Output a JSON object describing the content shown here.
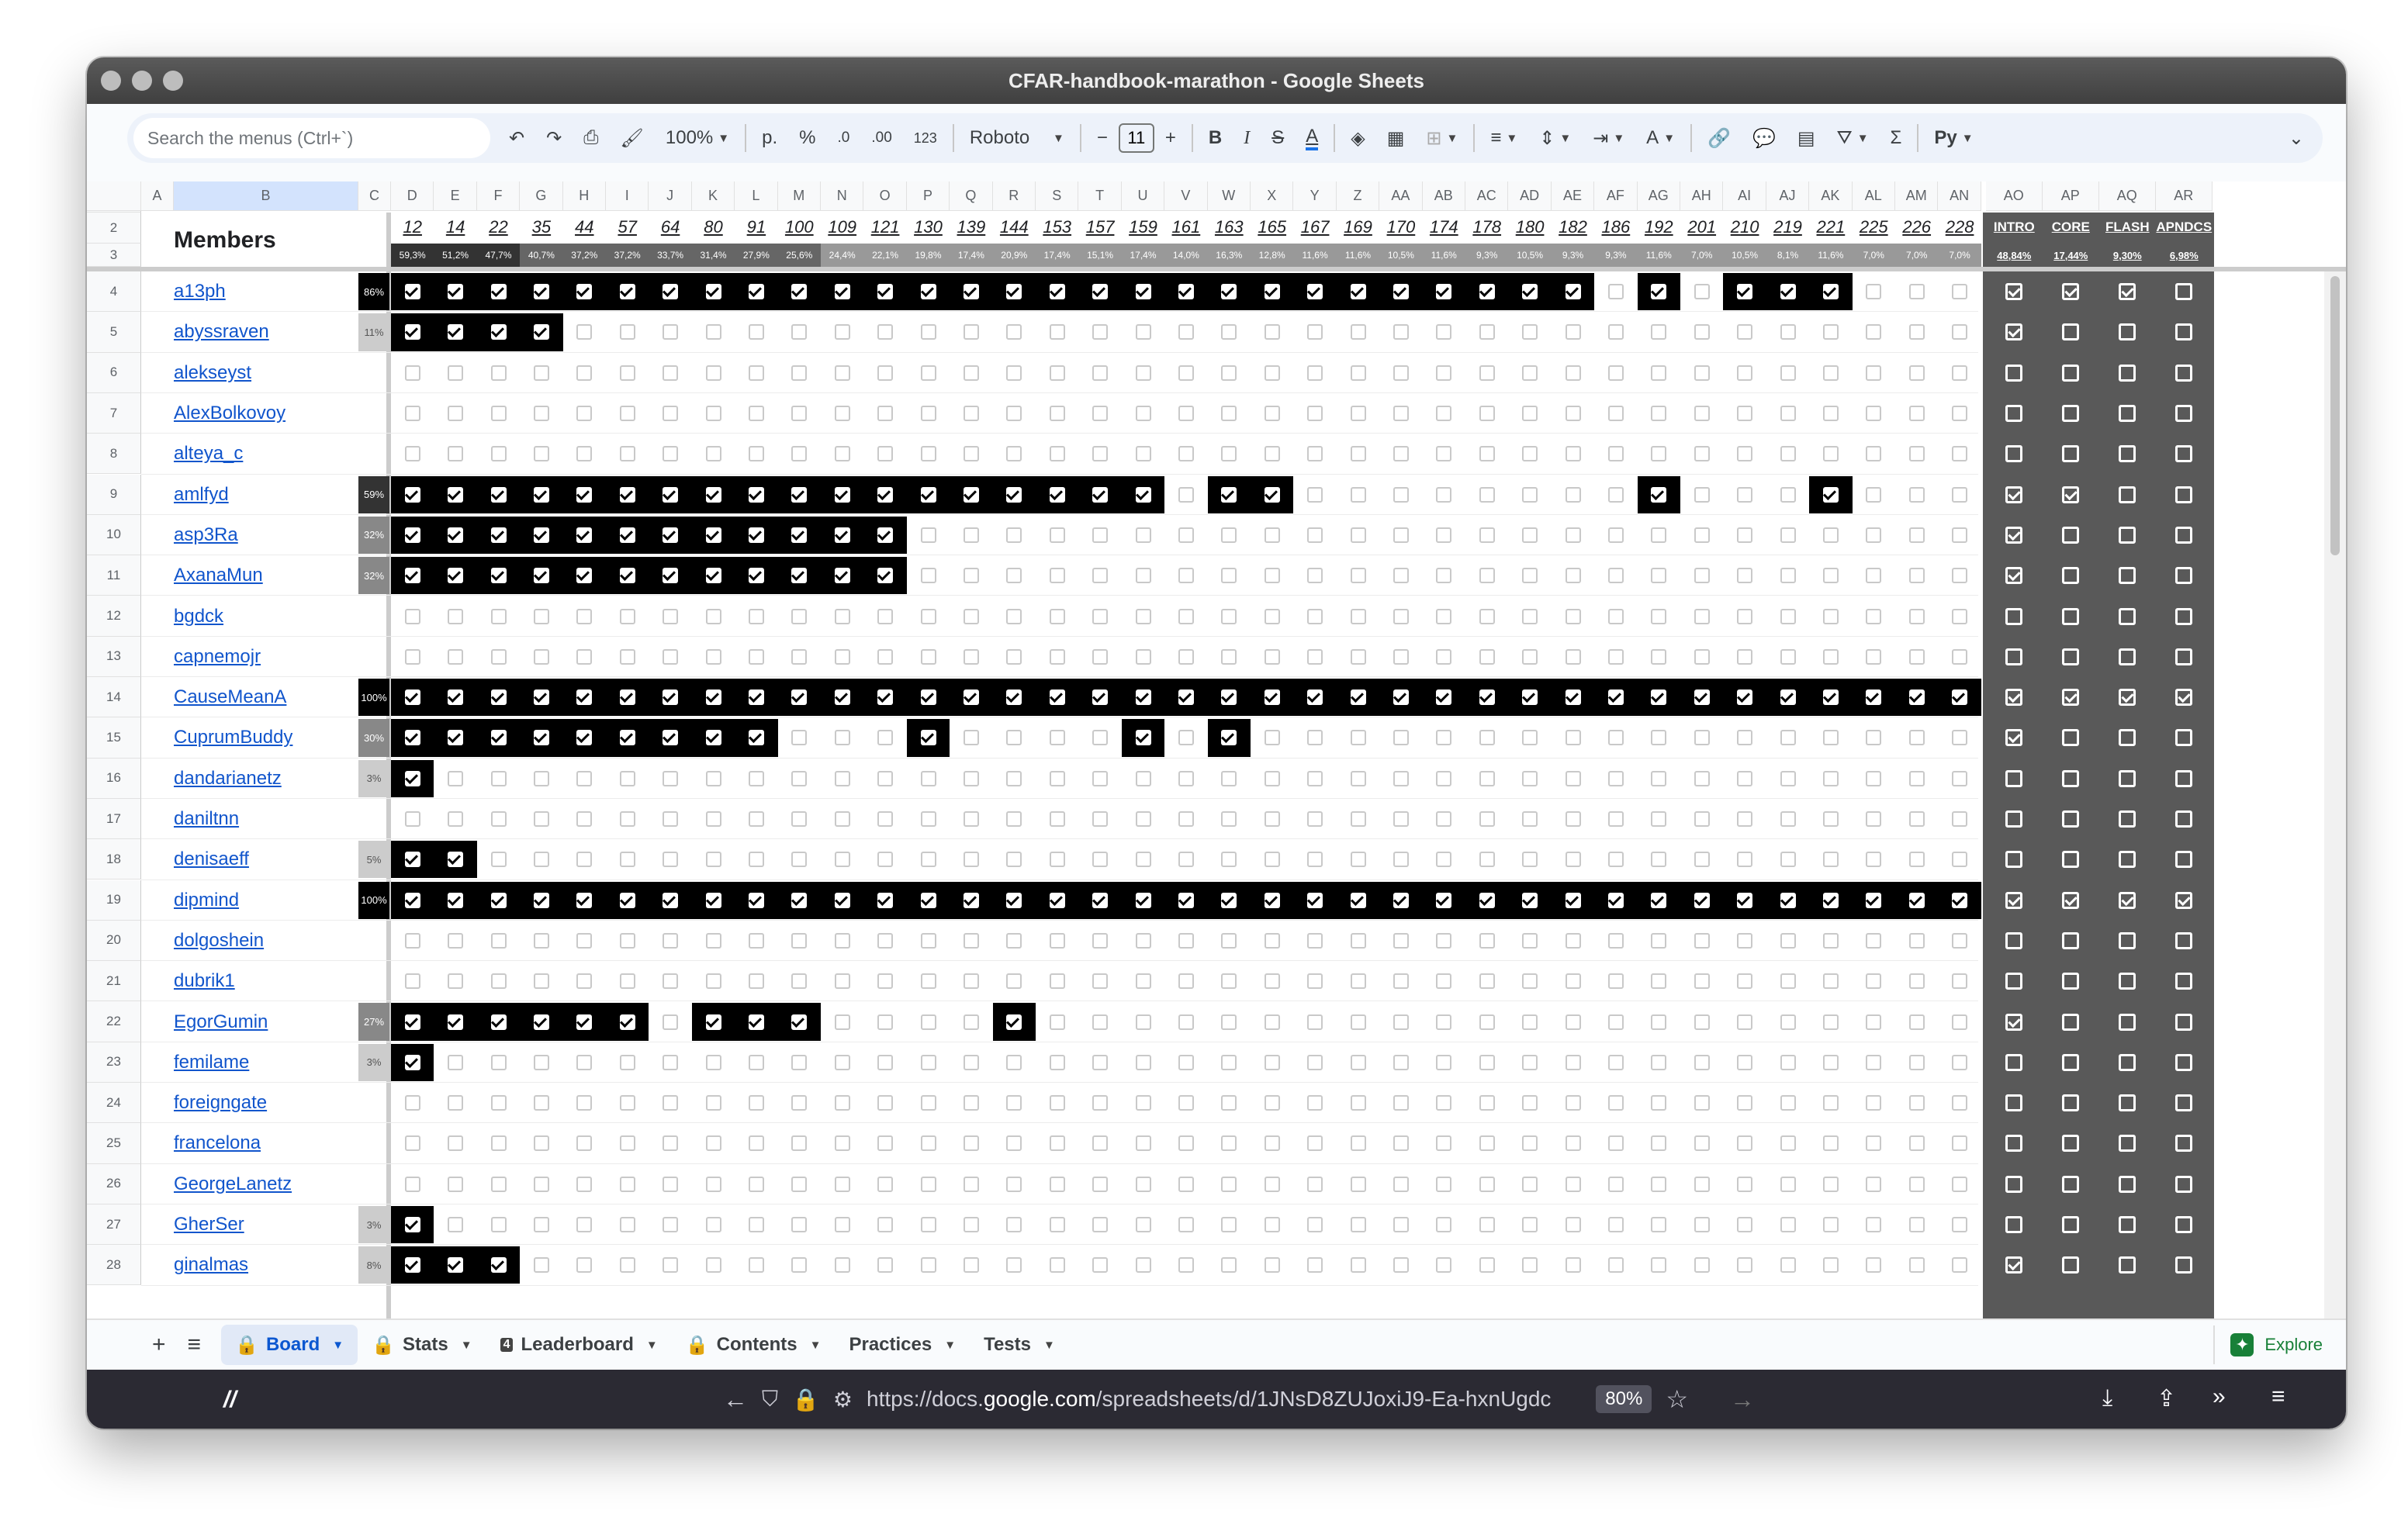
{
  "window": {
    "title": "CFAR-handbook-marathon - Google Sheets"
  },
  "toolbar": {
    "search_placeholder": "Search the menus (Ctrl+`)",
    "zoom": "100%",
    "currency": "р.",
    "percent": "%",
    "dec_decrease": ".0",
    "dec_increase": ".00",
    "number_format": "123",
    "font": "Roboto",
    "font_size": "11",
    "bold": "B",
    "italic": "I",
    "font_color": "A",
    "text_color": "A"
  },
  "columns": [
    "A",
    "B",
    "C",
    "D",
    "E",
    "F",
    "G",
    "H",
    "I",
    "J",
    "K",
    "L",
    "M",
    "N",
    "O",
    "P",
    "Q",
    "R",
    "S",
    "T",
    "U",
    "V",
    "W",
    "X",
    "Y",
    "Z",
    "AA",
    "AB",
    "AC",
    "AD",
    "AE",
    "AF",
    "AG",
    "AH",
    "AI",
    "AJ",
    "AK",
    "AL",
    "AM",
    "AN",
    "AO",
    "AP",
    "AQ",
    "AR"
  ],
  "members_header": "Members",
  "lessons": [
    "12",
    "14",
    "22",
    "35",
    "44",
    "57",
    "64",
    "80",
    "91",
    "100",
    "109",
    "121",
    "130",
    "139",
    "144",
    "153",
    "157",
    "159",
    "161",
    "163",
    "165",
    "167",
    "169",
    "170",
    "174",
    "178",
    "180",
    "182",
    "186",
    "192",
    "201",
    "210",
    "219",
    "221",
    "225",
    "226",
    "228"
  ],
  "lesson_pcts": [
    "59,3%",
    "51,2%",
    "47,7%",
    "40,7%",
    "37,2%",
    "37,2%",
    "33,7%",
    "31,4%",
    "27,9%",
    "25,6%",
    "24,4%",
    "22,1%",
    "19,8%",
    "17,4%",
    "20,9%",
    "17,4%",
    "15,1%",
    "17,4%",
    "14,0%",
    "16,3%",
    "12,8%",
    "11,6%",
    "11,6%",
    "10,5%",
    "11,6%",
    "9,3%",
    "10,5%",
    "9,3%",
    "9,3%",
    "11,6%",
    "7,0%",
    "10,5%",
    "8,1%",
    "11,6%",
    "7,0%",
    "7,0%",
    "7,0%"
  ],
  "categories": [
    "INTRO",
    "CORE",
    "FLASH",
    "APNDCS"
  ],
  "category_pcts": [
    "48,84%",
    "17,44%",
    "9,30%",
    "6,98%"
  ],
  "rows": [
    {
      "num": "4",
      "name": "a13ph",
      "pct": "86%",
      "done": "1111111111111111111111111111010111000",
      "cat": "1110"
    },
    {
      "num": "5",
      "name": "abyssraven",
      "pct": "11%",
      "done": "1111000000000000000000000000000000000",
      "cat": "1000"
    },
    {
      "num": "6",
      "name": "alekseyst",
      "pct": "",
      "done": "0000000000000000000000000000000000000",
      "cat": "0000"
    },
    {
      "num": "7",
      "name": "AlexBolkovoy",
      "pct": "",
      "done": "0000000000000000000000000000000000000",
      "cat": "0000"
    },
    {
      "num": "8",
      "name": "alteya_c",
      "pct": "",
      "done": "0000000000000000000000000000000000000",
      "cat": "0000"
    },
    {
      "num": "9",
      "name": "amlfyd",
      "pct": "59%",
      "done": "1111111111111111110110000000010001000",
      "cat": "1100"
    },
    {
      "num": "10",
      "name": "asp3Ra",
      "pct": "32%",
      "done": "1111111111110000000000000000000000000",
      "cat": "1000"
    },
    {
      "num": "11",
      "name": "AxanaMun",
      "pct": "32%",
      "done": "1111111111110000000000000000000000000",
      "cat": "1000"
    },
    {
      "num": "12",
      "name": "bgdck",
      "pct": "",
      "done": "0000000000000000000000000000000000000",
      "cat": "0000"
    },
    {
      "num": "13",
      "name": "capnemojr",
      "pct": "",
      "done": "0000000000000000000000000000000000000",
      "cat": "0000"
    },
    {
      "num": "14",
      "name": "CauseMeanA",
      "pct": "100%",
      "done": "1111111111111111111111111111111111111",
      "cat": "1111"
    },
    {
      "num": "15",
      "name": "CuprumBuddy",
      "pct": "30%",
      "done": "1111111110001000010100000000000000000",
      "cat": "1000"
    },
    {
      "num": "16",
      "name": "dandarianetz",
      "pct": "3%",
      "done": "1000000000000000000000000000000000000",
      "cat": "0000"
    },
    {
      "num": "17",
      "name": "daniltnn",
      "pct": "",
      "done": "0000000000000000000000000000000000000",
      "cat": "0000"
    },
    {
      "num": "18",
      "name": "denisaeff",
      "pct": "5%",
      "done": "1100000000000000000000000000000000000",
      "cat": "0000"
    },
    {
      "num": "19",
      "name": "dipmind",
      "pct": "100%",
      "done": "1111111111111111111111111111111111111",
      "cat": "1111"
    },
    {
      "num": "20",
      "name": "dolgoshein",
      "pct": "",
      "done": "0000000000000000000000000000000000000",
      "cat": "0000"
    },
    {
      "num": "21",
      "name": "dubrik1",
      "pct": "",
      "done": "0000000000000000000000000000000000000",
      "cat": "0000"
    },
    {
      "num": "22",
      "name": "EgorGumin",
      "pct": "27%",
      "done": "1111110111000010000000000000000000000",
      "cat": "1000"
    },
    {
      "num": "23",
      "name": "femilame",
      "pct": "3%",
      "done": "1000000000000000000000000000000000000",
      "cat": "0000"
    },
    {
      "num": "24",
      "name": "foreigngate",
      "pct": "",
      "done": "0000000000000000000000000000000000000",
      "cat": "0000"
    },
    {
      "num": "25",
      "name": "francelona",
      "pct": "",
      "done": "0000000000000000000000000000000000000",
      "cat": "0000"
    },
    {
      "num": "26",
      "name": "GeorgeLanetz",
      "pct": "",
      "done": "0000000000000000000000000000000000000",
      "cat": "0000"
    },
    {
      "num": "27",
      "name": "GherSer",
      "pct": "3%",
      "done": "1000000000000000000000000000000000000",
      "cat": "0000"
    },
    {
      "num": "28",
      "name": "ginalmas",
      "pct": "8%",
      "done": "1110000000000000000000000000000000000",
      "cat": "1000"
    }
  ],
  "sheets": {
    "add": "+",
    "menu": "≡",
    "tabs": [
      "Board",
      "Stats",
      "Leaderboard",
      "Contents",
      "Practices",
      "Tests"
    ],
    "explore": "Explore"
  },
  "browser": {
    "url_prefix": "https://docs.",
    "url_domain": "google.com",
    "url_rest": "/spreadsheets/d/1JNsD8ZUJoxiJ9-Ea-hxnUgdc",
    "zoom": "80%"
  },
  "colors": {
    "accent": "#0b57d0",
    "dark_header": "#595959",
    "done": "#000000"
  }
}
